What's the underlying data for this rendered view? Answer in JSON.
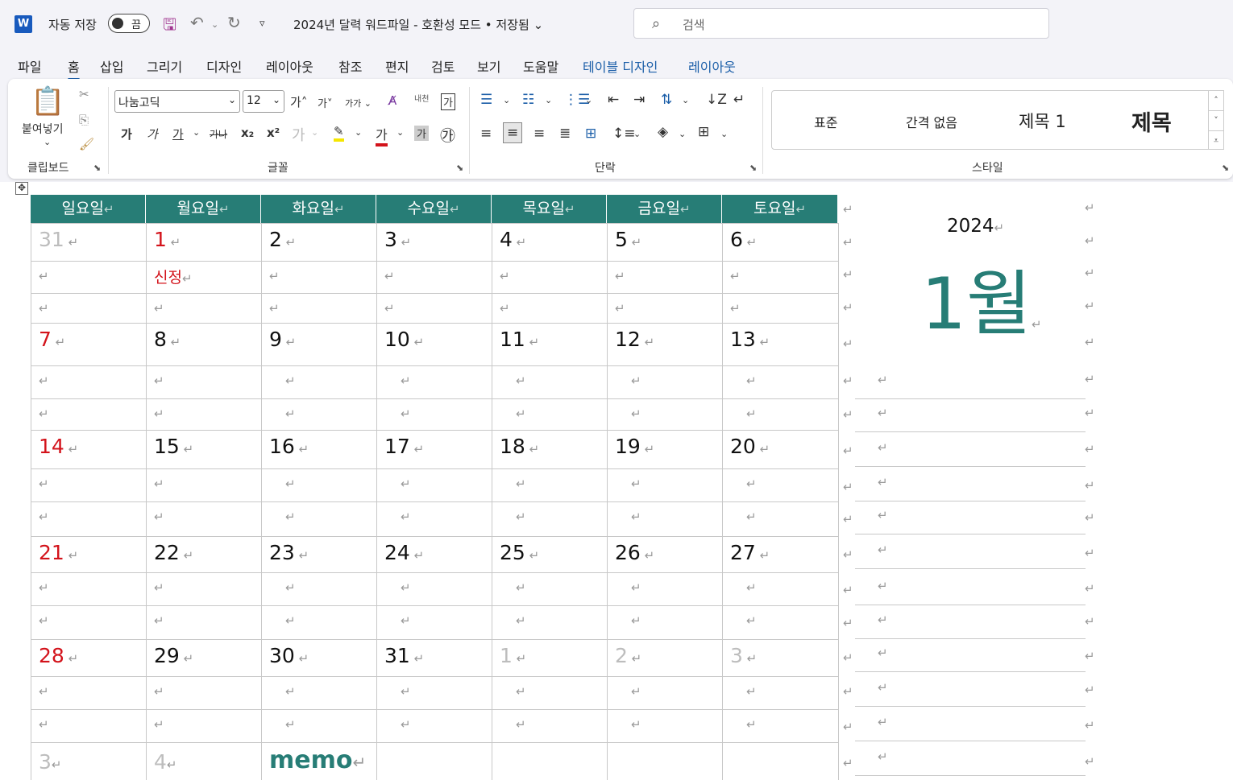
{
  "titlebar": {
    "app_icon": "W",
    "autosave_label": "자동 저장",
    "autosave_state": "끔",
    "doc_title": "2024년 달력 워드파일  -  호환성 모드 • 저장됨",
    "search_placeholder": "검색"
  },
  "tabs": [
    "파일",
    "홈",
    "삽입",
    "그리기",
    "디자인",
    "레이아웃",
    "참조",
    "편지",
    "검토",
    "보기",
    "도움말",
    "테이블 디자인",
    "레이아웃"
  ],
  "active_tab": "홈",
  "ribbon": {
    "paste_label": "붙여넣기",
    "groups": [
      "클립보드",
      "글꼴",
      "단락",
      "스타일"
    ],
    "font_name": "나눔고딕",
    "font_size": "12",
    "font_buttons": [
      "가",
      "가",
      "가",
      "가나",
      "x₂",
      "x²"
    ],
    "grow_font": "가",
    "shrink_font": "가",
    "case_button": "가가",
    "char_border": "가",
    "enclose_char": "㉮",
    "char_shade": "가",
    "phonetic_guide": "내천",
    "styles": [
      "표준",
      "간격 없음",
      "제목 1",
      "제목"
    ]
  },
  "calendar": {
    "weekday_headers": [
      "일요일",
      "월요일",
      "화요일",
      "수요일",
      "목요일",
      "금요일",
      "토요일"
    ],
    "weeks": [
      [
        "31",
        "1",
        "2",
        "3",
        "4",
        "5",
        "6"
      ],
      [
        "7",
        "8",
        "9",
        "10",
        "11",
        "12",
        "13"
      ],
      [
        "14",
        "15",
        "16",
        "17",
        "18",
        "19",
        "20"
      ],
      [
        "21",
        "22",
        "23",
        "24",
        "25",
        "26",
        "27"
      ],
      [
        "28",
        "29",
        "30",
        "31",
        "1",
        "2",
        "3"
      ]
    ],
    "extra_row": [
      "3",
      "4"
    ],
    "holiday_label": "신정",
    "memo_label": "memo",
    "year": "2024",
    "month": "1월",
    "paragraph_mark": "↵",
    "colors": {
      "header_bg": "#277d76",
      "sunday_holiday": "#d3131b",
      "outside_month": "#bdbdbd",
      "month_text": "#277d76"
    }
  }
}
